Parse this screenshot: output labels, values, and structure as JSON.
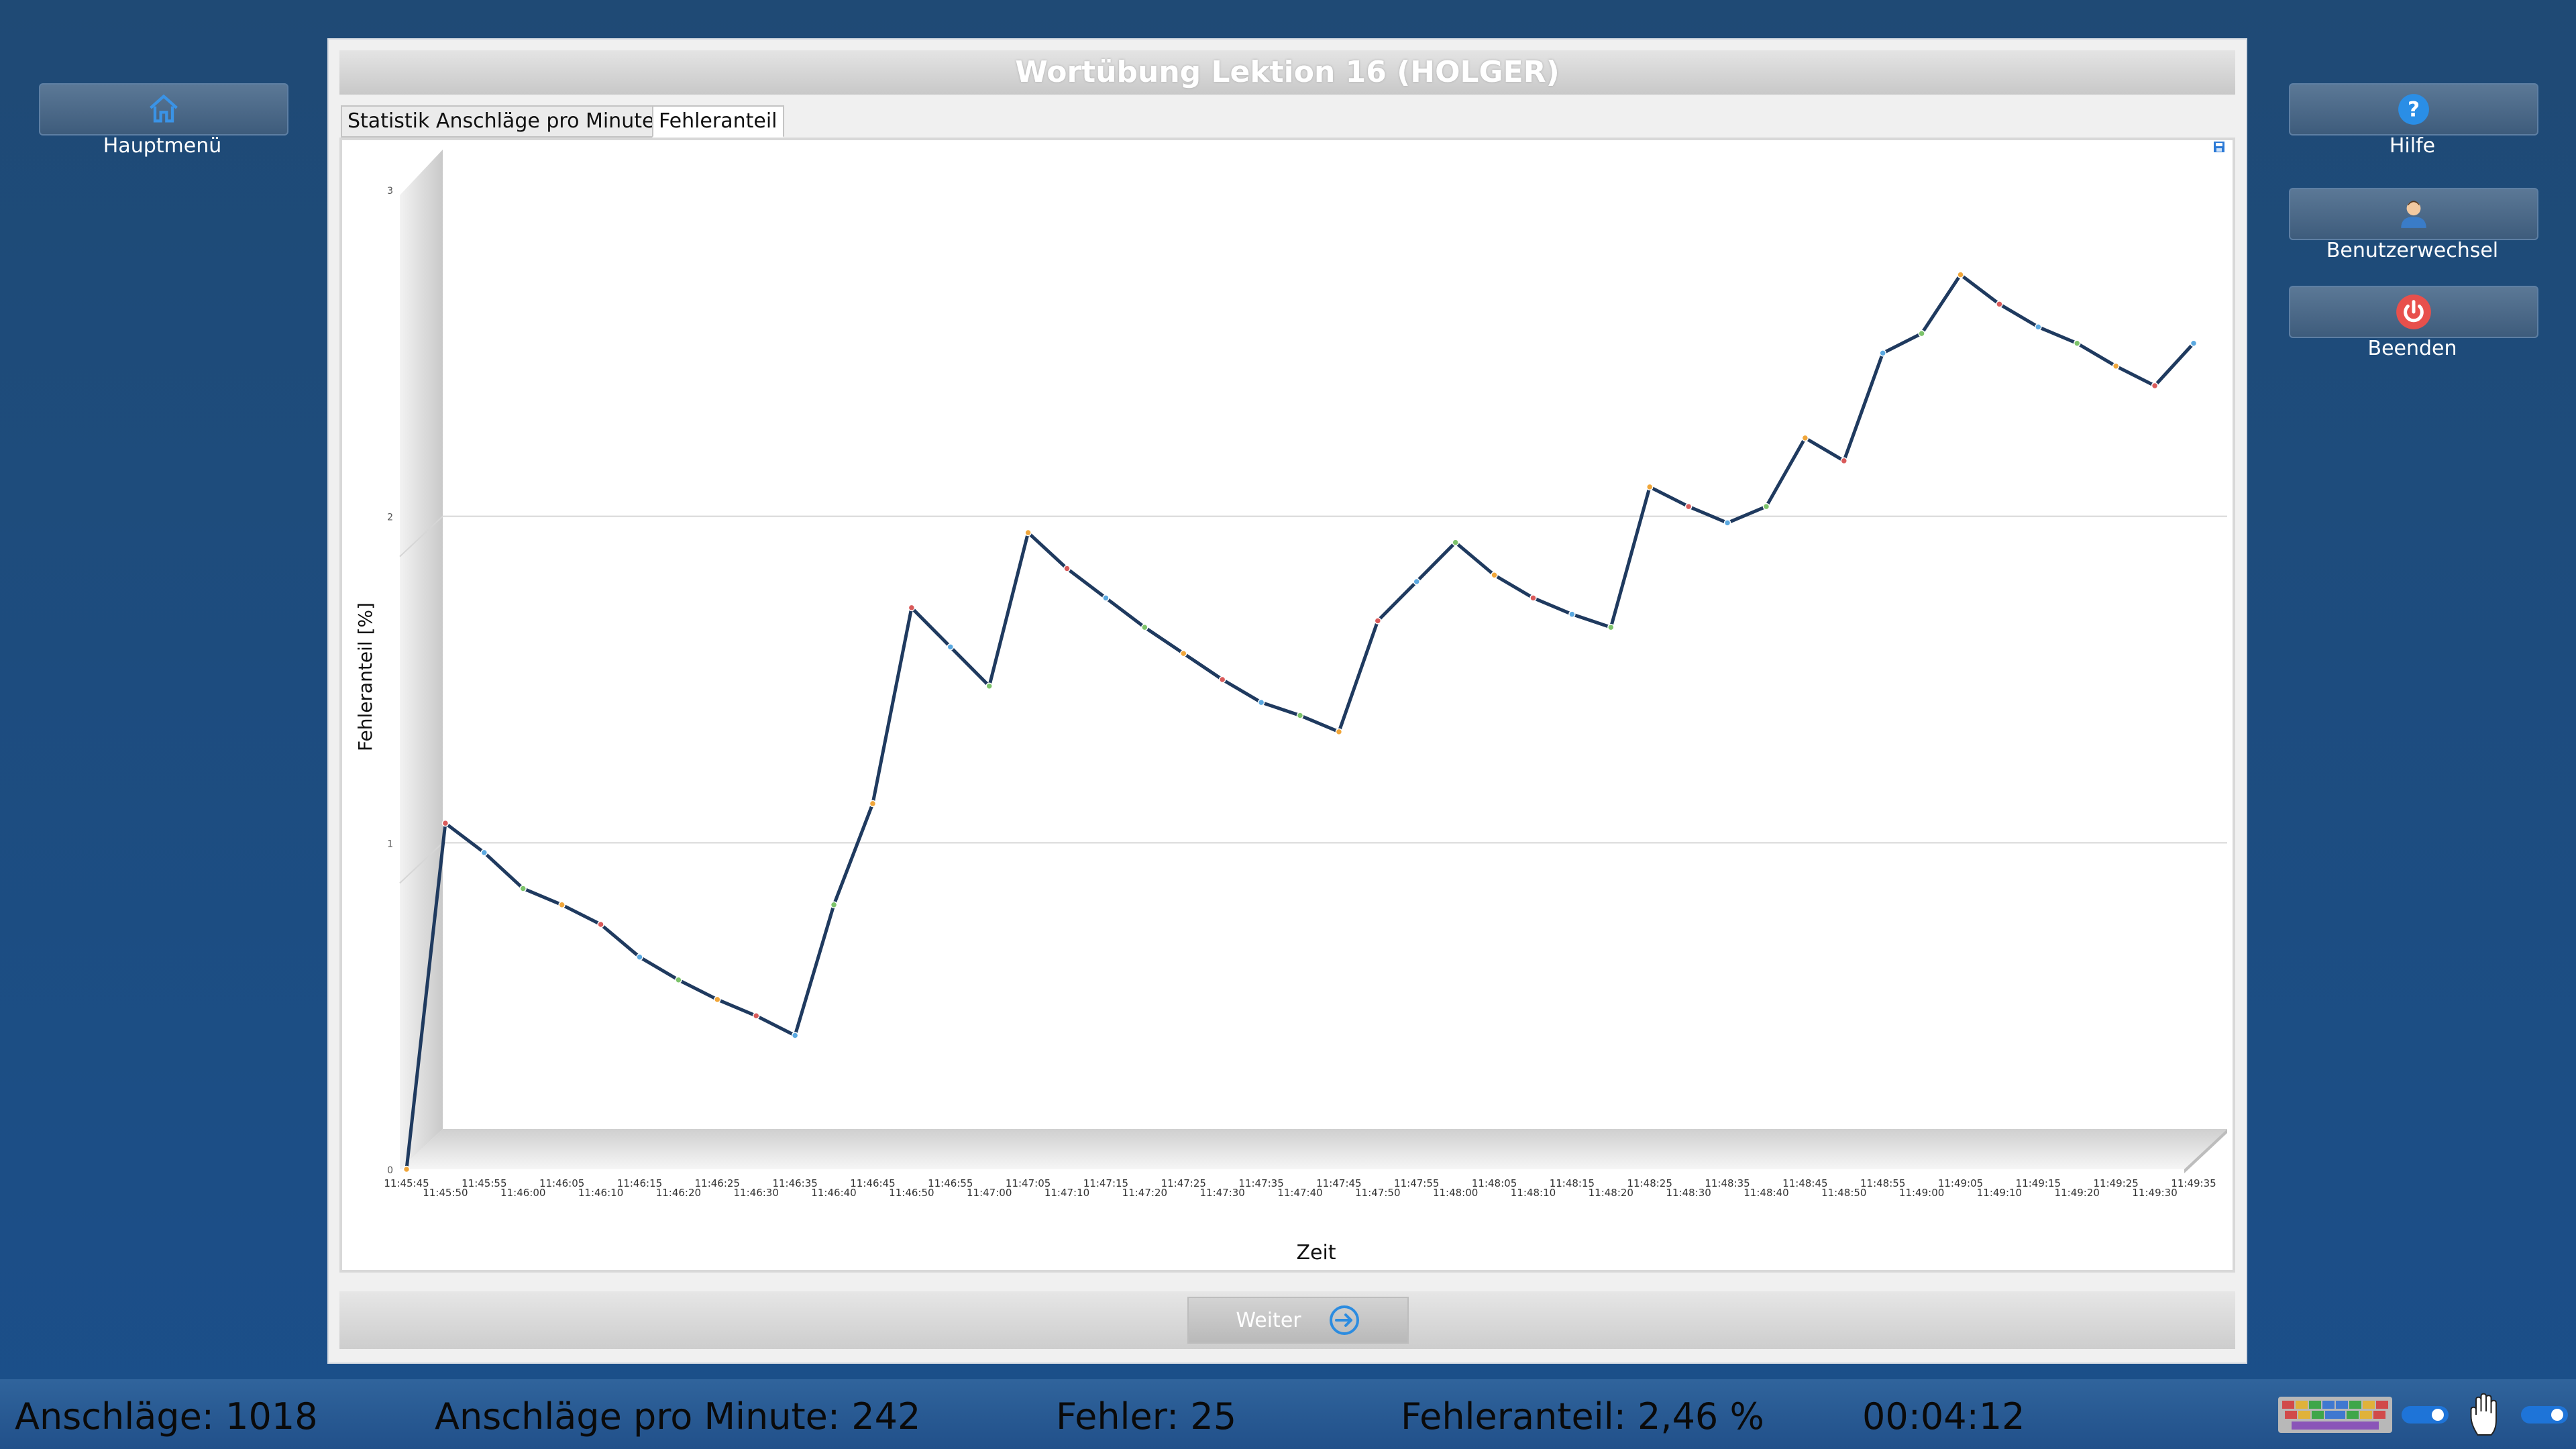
{
  "nav": {
    "home_label": "Hauptmenü",
    "help_label": "Hilfe",
    "switch_user_label": "Benutzerwechsel",
    "quit_label": "Beenden"
  },
  "dialog": {
    "title": "Wortübung Lektion 16 (HOLGER)",
    "tabs": [
      {
        "label": "Statistik Anschläge pro Minute",
        "active": false
      },
      {
        "label": "Fehleranteil",
        "active": true
      }
    ],
    "next_label": "Weiter"
  },
  "chart_data": {
    "type": "line",
    "title": "",
    "xlabel": "Zeit",
    "ylabel": "Fehleranteil [%]",
    "ylim": [
      0,
      3
    ],
    "yticks": [
      0,
      1,
      2,
      3
    ],
    "grid": true,
    "style": "3d",
    "x": [
      "11:45:45",
      "11:45:50",
      "11:45:55",
      "11:46:00",
      "11:46:05",
      "11:46:10",
      "11:46:15",
      "11:46:20",
      "11:46:25",
      "11:46:30",
      "11:46:35",
      "11:46:40",
      "11:46:45",
      "11:46:50",
      "11:46:55",
      "11:47:00",
      "11:47:05",
      "11:47:10",
      "11:47:15",
      "11:47:20",
      "11:47:25",
      "11:47:30",
      "11:47:35",
      "11:47:40",
      "11:47:45",
      "11:47:50",
      "11:47:55",
      "11:48:00",
      "11:48:05",
      "11:48:10",
      "11:48:15",
      "11:48:20",
      "11:48:25",
      "11:48:30",
      "11:48:35",
      "11:48:40",
      "11:48:45",
      "11:48:50",
      "11:48:55",
      "11:49:00",
      "11:49:05",
      "11:49:10",
      "11:49:15",
      "11:49:20",
      "11:49:25",
      "11:49:30",
      "11:49:35"
    ],
    "values": [
      0,
      1.06,
      0.97,
      0.86,
      0.81,
      0.75,
      0.65,
      0.58,
      0.52,
      0.47,
      0.41,
      0.81,
      1.12,
      1.72,
      1.6,
      1.48,
      1.95,
      1.84,
      1.75,
      1.66,
      1.58,
      1.5,
      1.43,
      1.39,
      1.34,
      1.68,
      1.8,
      1.92,
      1.82,
      1.75,
      1.7,
      1.66,
      2.09,
      2.03,
      1.98,
      2.03,
      2.24,
      2.17,
      2.5,
      2.56,
      2.74,
      2.65,
      2.58,
      2.53,
      2.46,
      2.4,
      2.53
    ]
  },
  "status": {
    "keystrokes": "Anschläge: 1018",
    "kpm": "Anschläge pro Minute: 242",
    "errors": "Fehler: 25",
    "error_rate": "Fehleranteil: 2,46 %",
    "time": "00:04:12"
  },
  "colors": {
    "line": "#1f3a5f",
    "accent": "#2c8ce0",
    "quit": "#e8504c"
  }
}
